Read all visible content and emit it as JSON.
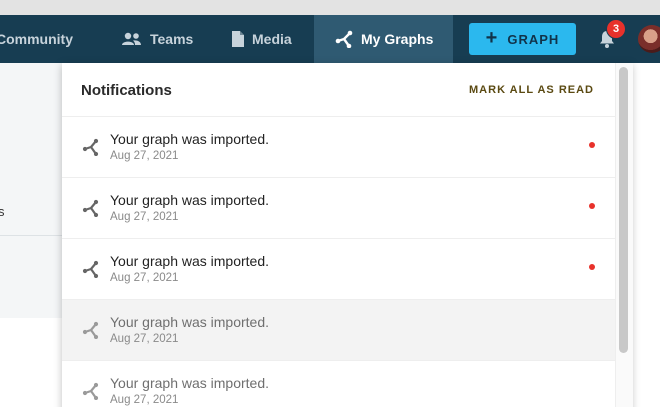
{
  "nav": {
    "community": "Community",
    "teams": "Teams",
    "media": "Media",
    "my_graphs": "My Graphs",
    "graph_button": "GRAPH",
    "notification_count": "3"
  },
  "notifications": {
    "title": "Notifications",
    "mark_all_read": "MARK ALL AS READ",
    "items": [
      {
        "message": "Your graph was imported.",
        "date": "Aug 27, 2021",
        "unread": true
      },
      {
        "message": "Your graph was imported.",
        "date": "Aug 27, 2021",
        "unread": true
      },
      {
        "message": "Your graph was imported.",
        "date": "Aug 27, 2021",
        "unread": true
      },
      {
        "message": "Your graph was imported.",
        "date": "Aug 27, 2021",
        "unread": false
      },
      {
        "message": "Your graph was imported.",
        "date": "Aug 27, 2021",
        "unread": false
      }
    ]
  },
  "background": {
    "partial_text": "s"
  },
  "colors": {
    "navbar": "#173d52",
    "nav_active": "#2f5a72",
    "accent_button": "#2bb8ee",
    "badge": "#e8312b",
    "unread_dot": "#e8312b"
  },
  "icons": {
    "community": "community-icon",
    "teams": "people-icon",
    "media": "document-icon",
    "my_graphs": "graph-node-icon",
    "bell": "bell-icon",
    "notification": "graph-node-icon"
  }
}
